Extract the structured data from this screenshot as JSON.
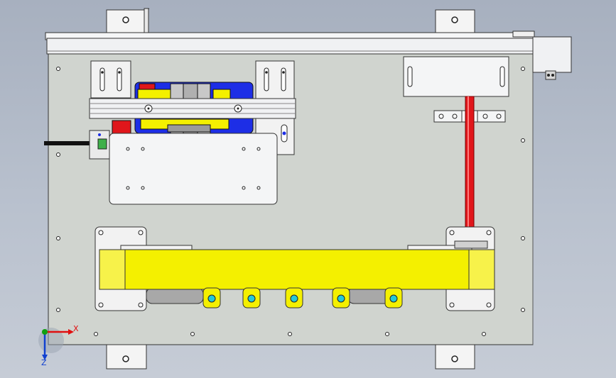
{
  "viewport": {
    "background_top": "#a7b0bf",
    "background_bottom": "#c6ccd6"
  },
  "model": {
    "plate_color": "#d0d4cf",
    "frame_color": "#eef0f2",
    "belt_color": "#f4f000",
    "rod_color": "#e0161b",
    "motor_color": "#1d2ee6",
    "bracket_color": "#f2f2f2",
    "line_color": "#2a2a2a"
  },
  "triad": {
    "x_label": "X",
    "z_label": "Z",
    "x_color": "#e01010",
    "y_color": "#10a010",
    "z_color": "#1040d0"
  }
}
